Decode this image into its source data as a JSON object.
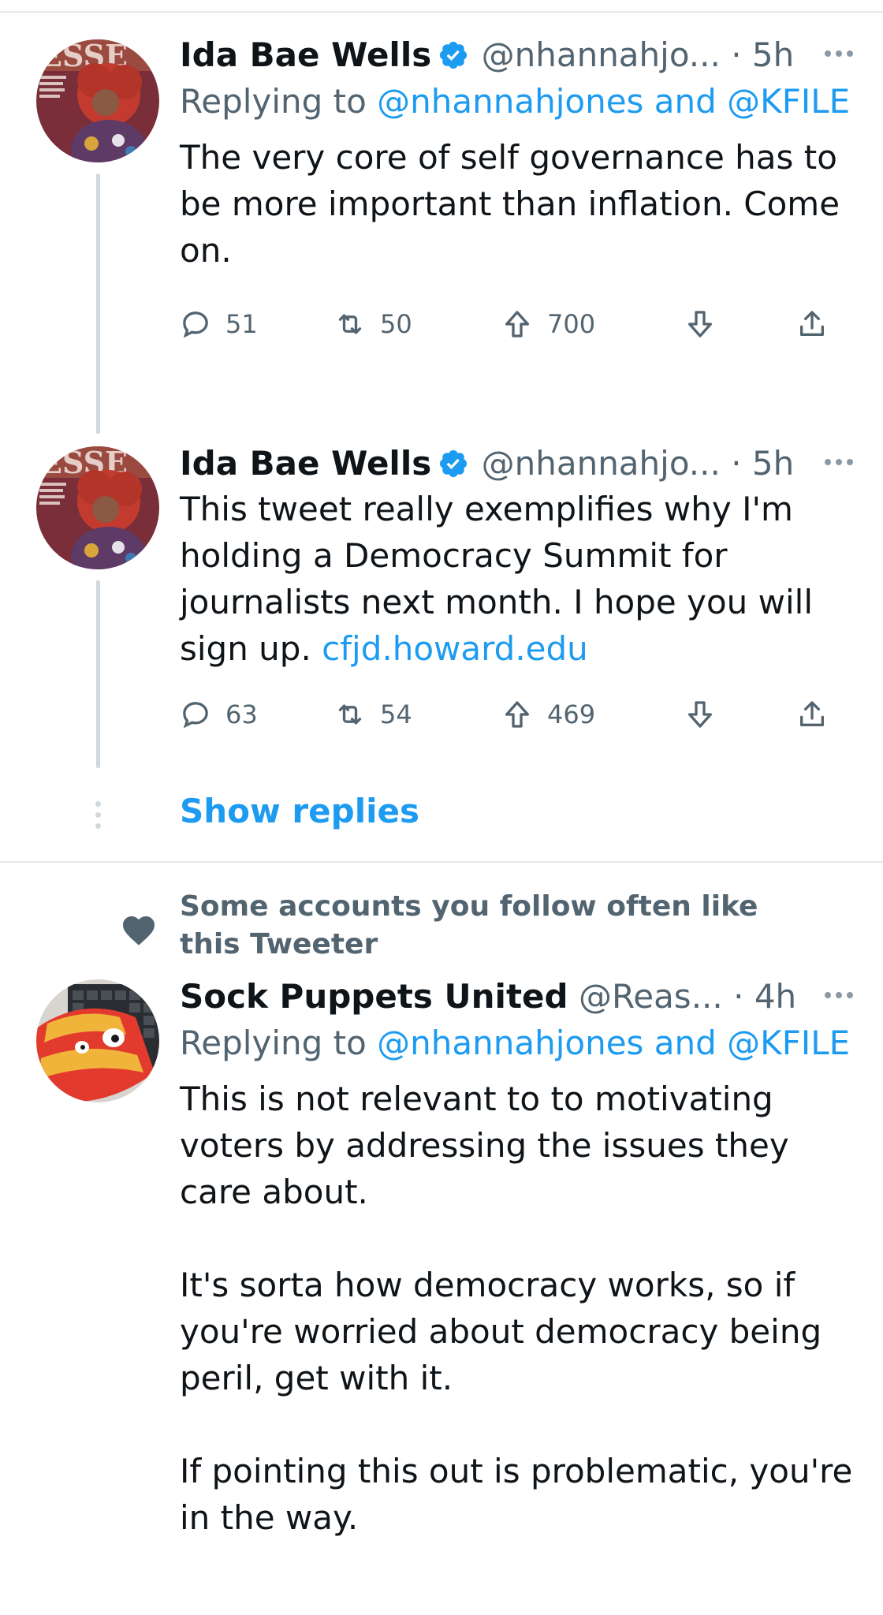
{
  "tweets": [
    {
      "display_name": "Ida Bae Wells",
      "handle": "@nhannahjo...",
      "separator": "·",
      "time": "5h",
      "reply_prefix": "Replying to",
      "reply_mentions": "@nhannahjones and @KFILE",
      "text_lines": [
        "The very core of self governance has to be more important than inflation. Come on."
      ],
      "replies": "51",
      "retweets": "50",
      "upvotes": "700"
    },
    {
      "display_name": "Ida Bae Wells",
      "handle": "@nhannahjo...",
      "separator": "·",
      "time": "5h",
      "text": "This tweet really exemplifies why I'm holding a Democracy Summit for journalists next month. I hope you will sign up.",
      "link": "cfjd.howard.edu",
      "replies": "63",
      "retweets": "54",
      "upvotes": "469"
    },
    {
      "display_name": "Sock Puppets United",
      "handle": "@Reas...",
      "separator": "·",
      "time": "4h",
      "reply_prefix": "Replying to",
      "reply_mentions": "@nhannahjones and @KFILE",
      "paragraphs": [
        "This is not relevant to to motivating voters by addressing the issues they care about.",
        "It's sorta how democracy works, so if you're worried about democracy being peril, get with it.",
        "If pointing this out is problematic, you're in the way."
      ]
    }
  ],
  "show_replies_label": "Show replies",
  "social_context": "Some accounts you follow often like this Tweeter",
  "colors": {
    "accent": "#1d9bf0",
    "secondary_text": "#536471",
    "thread_line": "#cfd9de",
    "divider": "#e7e9ea"
  }
}
